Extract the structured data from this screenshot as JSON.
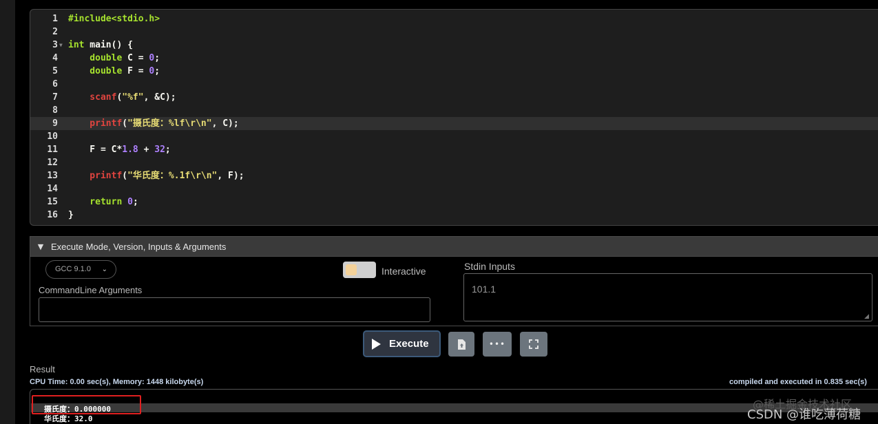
{
  "editor": {
    "lines": [
      {
        "n": "1",
        "tokens": [
          {
            "t": "#include<stdio.h>",
            "c": "k"
          }
        ]
      },
      {
        "n": "2",
        "tokens": []
      },
      {
        "n": "3",
        "fold": true,
        "tokens": [
          {
            "t": "int",
            "c": "k"
          },
          {
            "t": " main() {",
            "c": "p"
          }
        ]
      },
      {
        "n": "4",
        "tokens": [
          {
            "t": "    double",
            "c": "k"
          },
          {
            "t": " C = ",
            "c": "p"
          },
          {
            "t": "0",
            "c": "n"
          },
          {
            "t": ";",
            "c": "p"
          }
        ]
      },
      {
        "n": "5",
        "tokens": [
          {
            "t": "    double",
            "c": "k"
          },
          {
            "t": " F = ",
            "c": "p"
          },
          {
            "t": "0",
            "c": "n"
          },
          {
            "t": ";",
            "c": "p"
          }
        ]
      },
      {
        "n": "6",
        "tokens": []
      },
      {
        "n": "7",
        "tokens": [
          {
            "t": "    scanf",
            "c": "f"
          },
          {
            "t": "(",
            "c": "p"
          },
          {
            "t": "\"%f\"",
            "c": "s"
          },
          {
            "t": ", &C);",
            "c": "p"
          }
        ]
      },
      {
        "n": "8",
        "tokens": []
      },
      {
        "n": "9",
        "active": true,
        "tokens": [
          {
            "t": "    printf",
            "c": "f"
          },
          {
            "t": "(",
            "c": "p"
          },
          {
            "t": "\"摄氏度：%lf\\r\\n\"",
            "c": "s"
          },
          {
            "t": ", C);",
            "c": "p"
          }
        ]
      },
      {
        "n": "10",
        "tokens": []
      },
      {
        "n": "11",
        "tokens": [
          {
            "t": "    F = C*",
            "c": "p"
          },
          {
            "t": "1.8",
            "c": "n"
          },
          {
            "t": " + ",
            "c": "p"
          },
          {
            "t": "32",
            "c": "n"
          },
          {
            "t": ";",
            "c": "p"
          }
        ]
      },
      {
        "n": "12",
        "tokens": []
      },
      {
        "n": "13",
        "tokens": [
          {
            "t": "    printf",
            "c": "f"
          },
          {
            "t": "(",
            "c": "p"
          },
          {
            "t": "\"华氏度：%.1f\\r\\n\"",
            "c": "s"
          },
          {
            "t": ", F);",
            "c": "p"
          }
        ]
      },
      {
        "n": "14",
        "tokens": []
      },
      {
        "n": "15",
        "tokens": [
          {
            "t": "    return",
            "c": "k"
          },
          {
            "t": " ",
            "c": "p"
          },
          {
            "t": "0",
            "c": "n"
          },
          {
            "t": ";",
            "c": "p"
          }
        ]
      },
      {
        "n": "16",
        "tokens": [
          {
            "t": "}",
            "c": "p"
          }
        ]
      }
    ]
  },
  "panel": {
    "title": "Execute Mode, Version, Inputs & Arguments",
    "version": "GCC 9.1.0",
    "interactive_label": "Interactive",
    "cmd_label": "CommandLine Arguments",
    "cmd_value": "",
    "stdin_label": "Stdin Inputs",
    "stdin_value": "101.1"
  },
  "toolbar": {
    "execute_label": "Execute"
  },
  "result": {
    "label": "Result",
    "stats": "CPU Time: 0.00 sec(s), Memory: 1448 kilobyte(s)",
    "compiled": "compiled and executed in 0.835 sec(s)",
    "output": [
      "摄氏度：0.000000",
      "华氏度：32.0"
    ]
  },
  "watermark": {
    "line1": "@稀土掘金技术社区",
    "line2": "CSDN @谁吃薄荷糖"
  },
  "colors": {
    "keyword": "#a6e22e",
    "function": "#e0443f",
    "string": "#e6db74",
    "number": "#ae81ff",
    "highlight_box": "#e02020"
  }
}
